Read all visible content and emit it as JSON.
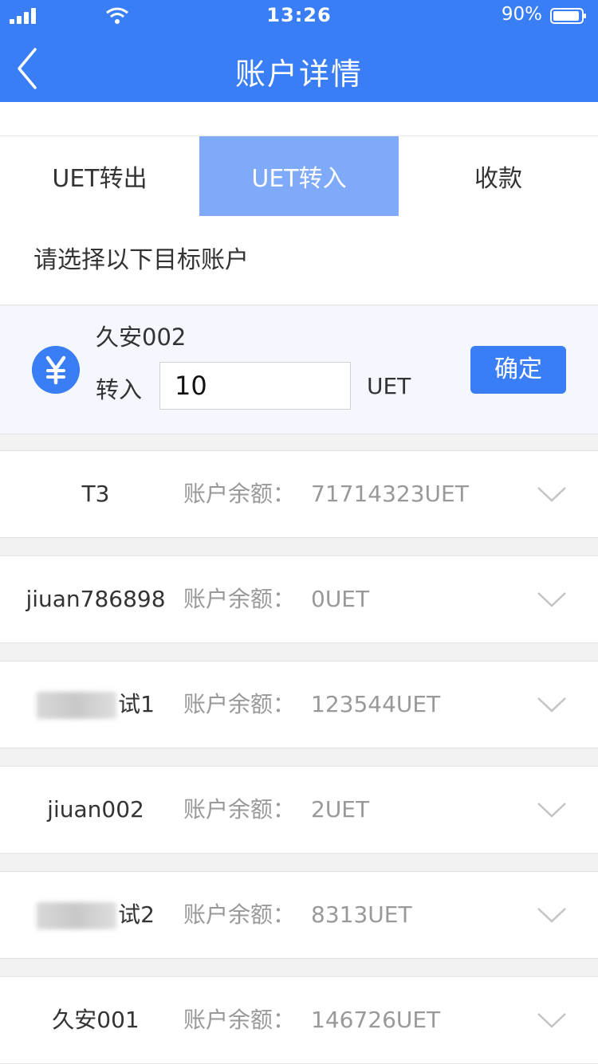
{
  "status": {
    "time": "13:26",
    "battery": "90%"
  },
  "nav": {
    "title": "账户详情"
  },
  "tabs": [
    {
      "label": "UET转出"
    },
    {
      "label": "UET转入"
    },
    {
      "label": "收款"
    }
  ],
  "active_tab": "UET转入",
  "prompt": "请选择以下目标账户",
  "transfer": {
    "target": "久安002",
    "label": "转入",
    "amount": "10",
    "unit": "UET",
    "confirm": "确定"
  },
  "balance_label": "账户余额：",
  "accounts": [
    {
      "name": "T3",
      "balance": "71714323UET"
    },
    {
      "name": "jiuan786898",
      "balance": "0UET"
    },
    {
      "name": "试1",
      "balance": "123544UET"
    },
    {
      "name": "jiuan002",
      "balance": "2UET"
    },
    {
      "name": "试2",
      "balance": "8313UET"
    },
    {
      "name": "久安001",
      "balance": "146726UET"
    }
  ]
}
